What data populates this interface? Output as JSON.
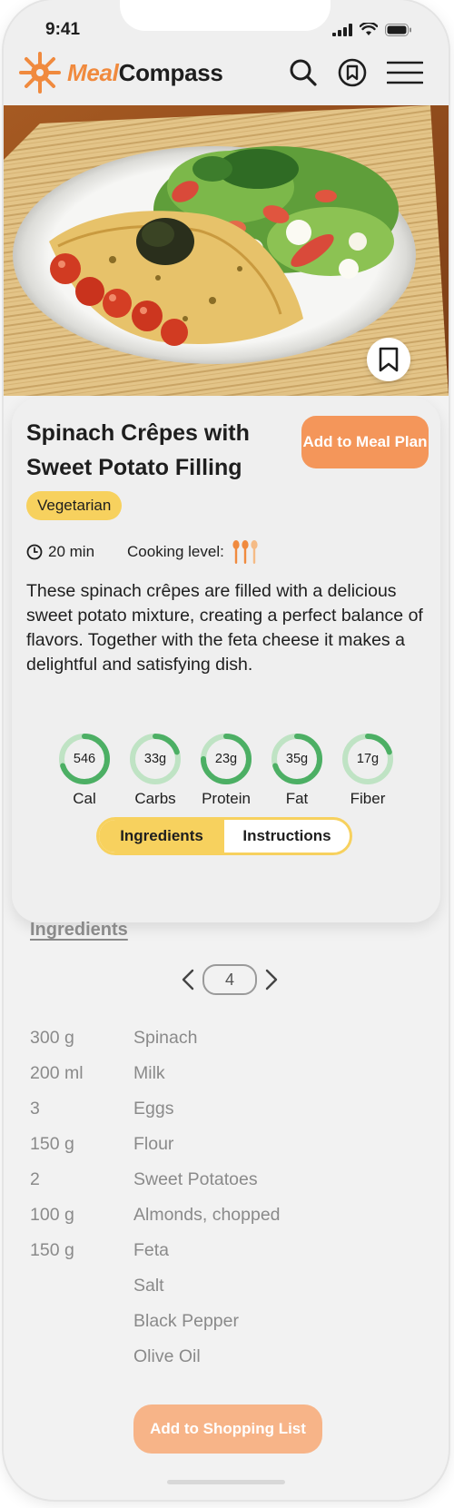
{
  "status_bar": {
    "time": "9:41"
  },
  "header": {
    "logo_meal": "Meal",
    "logo_compass": "Compass",
    "icons": [
      "search-icon",
      "bookmark-icon",
      "menu-icon"
    ]
  },
  "recipe": {
    "title": "Spinach Crêpes with Sweet Potato Filling",
    "add_to_meal_plan": "Add to Meal Plan",
    "tag": "Vegetarian",
    "time": "20 min",
    "cooking_level_label": "Cooking level:",
    "cooking_level": 3,
    "description": "These spinach crêpes are filled with a delicious sweet potato mixture, creating a perfect balance of flavors. Together with the feta cheese it makes a delightful and satisfying dish."
  },
  "nutrition": [
    {
      "value": "546",
      "label": "Cal",
      "fill": 0.7
    },
    {
      "value": "33g",
      "label": "Carbs",
      "fill": 0.2
    },
    {
      "value": "23g",
      "label": "Protein",
      "fill": 0.75
    },
    {
      "value": "35g",
      "label": "Fat",
      "fill": 0.7
    },
    {
      "value": "17g",
      "label": "Fiber",
      "fill": 0.2
    }
  ],
  "tabs": {
    "ingredients": "Ingredients",
    "instructions": "Instructions",
    "active": "ingredients"
  },
  "ingredients_section": {
    "title": "Ingredients",
    "servings": "4",
    "items": [
      {
        "qty": "300 g",
        "name": "Spinach"
      },
      {
        "qty": "200 ml",
        "name": "Milk"
      },
      {
        "qty": "3",
        "name": "Eggs"
      },
      {
        "qty": "150 g",
        "name": "Flour"
      },
      {
        "qty": "2",
        "name": "Sweet Potatoes"
      },
      {
        "qty": "100 g",
        "name": "Almonds, chopped"
      },
      {
        "qty": "150 g",
        "name": "Feta"
      },
      {
        "qty": "",
        "name": "Salt"
      },
      {
        "qty": "",
        "name": "Black Pepper"
      },
      {
        "qty": "",
        "name": "Olive Oil"
      }
    ],
    "add_to_shopping_list": "Add to Shopping List"
  },
  "colors": {
    "accent_orange": "#f4965a",
    "tag_yellow": "#f7d15e",
    "ring_green": "#4caf64",
    "ring_track": "#bfe3c4"
  }
}
